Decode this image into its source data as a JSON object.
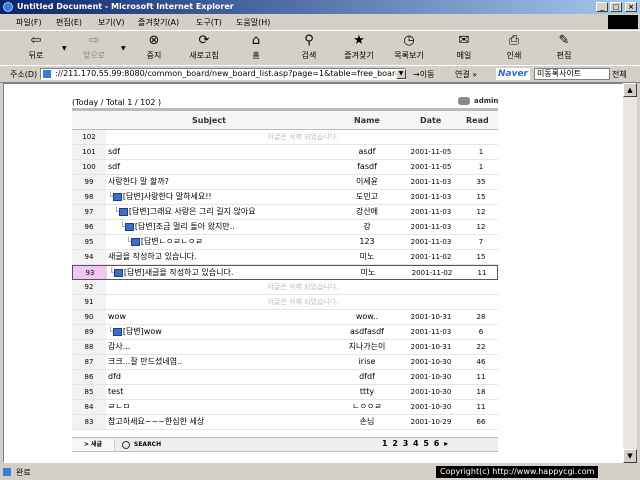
{
  "window": {
    "title": "Untitled Document - Microsoft Internet Explorer",
    "btn_min": "_",
    "btn_max": "□",
    "btn_close": "×"
  },
  "menu": [
    "파일(F)",
    "편집(E)",
    "보기(V)",
    "즐겨찾기(A)",
    "도구(T)",
    "도움말(H)"
  ],
  "toolbar": [
    {
      "label": "뒤로",
      "icon": "back-arrow-icon",
      "glyph": "⇦",
      "enabled": true
    },
    {
      "label": "앞으로",
      "icon": "forward-arrow-icon",
      "glyph": "⇨",
      "enabled": false
    },
    {
      "label": "중지",
      "icon": "stop-icon",
      "glyph": "⊗",
      "enabled": true
    },
    {
      "label": "새로고침",
      "icon": "refresh-icon",
      "glyph": "⟳",
      "enabled": true
    },
    {
      "label": "홈",
      "icon": "home-icon",
      "glyph": "⌂",
      "enabled": true
    },
    {
      "label": "검색",
      "icon": "search-icon",
      "glyph": "⚲",
      "enabled": true
    },
    {
      "label": "즐겨찾기",
      "icon": "favorites-icon",
      "glyph": "★",
      "enabled": true
    },
    {
      "label": "목록보기",
      "icon": "history-icon",
      "glyph": "◷",
      "enabled": true
    },
    {
      "label": "메일",
      "icon": "mail-icon",
      "glyph": "✉",
      "enabled": true
    },
    {
      "label": "인쇄",
      "icon": "print-icon",
      "glyph": "⎙",
      "enabled": true
    },
    {
      "label": "편집",
      "icon": "edit-icon",
      "glyph": "✎",
      "enabled": true
    }
  ],
  "address": {
    "label": "주소(D)",
    "url": "://211.170.55.99:8080/common_board/new_board_list.asp?page=1&table=free_board",
    "go": "이동",
    "links": "연결 »",
    "naver_logo": "Naver",
    "naver_search_value": "미동록사이트",
    "naver_scope": "전체"
  },
  "board": {
    "info": "(Today / Total 1 / 102 )",
    "admin_label": "admin",
    "headers": {
      "subject": "Subject",
      "name": "Name",
      "date": "Date",
      "read": "Read"
    },
    "rows": [
      {
        "num": "102",
        "deleted": "이글은 삭제 되었습니다."
      },
      {
        "num": "101",
        "subject": "sdf",
        "name": "asdf",
        "date": "2001-11-05",
        "read": "1",
        "depth": 0
      },
      {
        "num": "100",
        "subject": "sdf",
        "name": "fasdf",
        "date": "2001-11-05",
        "read": "1",
        "depth": 0
      },
      {
        "num": "99",
        "subject": "사랑한다 말 할까?",
        "name": "이세윤",
        "date": "2001-11-03",
        "read": "35",
        "depth": 0
      },
      {
        "num": "98",
        "subject": "[답변]사랑한다 말하세요!!",
        "name": "도민고",
        "date": "2001-11-03",
        "read": "15",
        "depth": 1
      },
      {
        "num": "97",
        "subject": "[답변]그래요 사랑은 그리 길지 않아요",
        "name": "강산에",
        "date": "2001-11-03",
        "read": "12",
        "depth": 2
      },
      {
        "num": "96",
        "subject": "[답변]조금 멀리 돌아 왔지만..",
        "name": "강",
        "date": "2001-11-03",
        "read": "12",
        "depth": 3
      },
      {
        "num": "95",
        "subject": "[답변ㄴㅇㄹㄴㅇㄹ",
        "name": "123",
        "date": "2001-11-03",
        "read": "7",
        "depth": 4
      },
      {
        "num": "94",
        "subject": "새글을 작성하고 있습니다.",
        "name": "미노",
        "date": "2001-11-02",
        "read": "15",
        "depth": 0
      },
      {
        "num": "93",
        "subject": "[답변]새글을 작성하고 있습니다.",
        "name": "미노",
        "date": "2001-11-02",
        "read": "11",
        "depth": 1,
        "current": true
      },
      {
        "num": "92",
        "deleted": "이글은 삭제 되었습니다."
      },
      {
        "num": "91",
        "deleted": "이글은 삭제 되었습니다."
      },
      {
        "num": "90",
        "subject": "wow",
        "name": "wow..",
        "date": "2001-10-31",
        "read": "28",
        "depth": 0
      },
      {
        "num": "89",
        "subject": "[답변]wow",
        "name": "asdfasdf",
        "date": "2001-11-03",
        "read": "6",
        "depth": 1
      },
      {
        "num": "88",
        "subject": "감사...",
        "name": "지나가는이",
        "date": "2001-10-31",
        "read": "22",
        "depth": 0
      },
      {
        "num": "87",
        "subject": "크크...잘 만드셨네염..",
        "name": "irise",
        "date": "2001-10-30",
        "read": "46",
        "depth": 0
      },
      {
        "num": "86",
        "subject": "dfd",
        "name": "dfdf",
        "date": "2001-10-30",
        "read": "11",
        "depth": 0
      },
      {
        "num": "85",
        "subject": "test",
        "name": "ttty",
        "date": "2001-10-30",
        "read": "18",
        "depth": 0
      },
      {
        "num": "84",
        "subject": "ㄹㄴㅁ",
        "name": "ㄴㅇㅇㄹ",
        "date": "2001-10-30",
        "read": "11",
        "depth": 0
      },
      {
        "num": "83",
        "subject": "참고하세요~~~한심한 세상",
        "name": "손님",
        "date": "2001-10-29",
        "read": "66",
        "depth": 0
      }
    ],
    "footer": {
      "new_label": "> 새글",
      "search_label": "SEARCH",
      "pages": "1 2 3 4 5 6 ▸"
    }
  },
  "status": {
    "text": "완료",
    "copyright": "Copyright(c) http://www.happycgi.com"
  }
}
